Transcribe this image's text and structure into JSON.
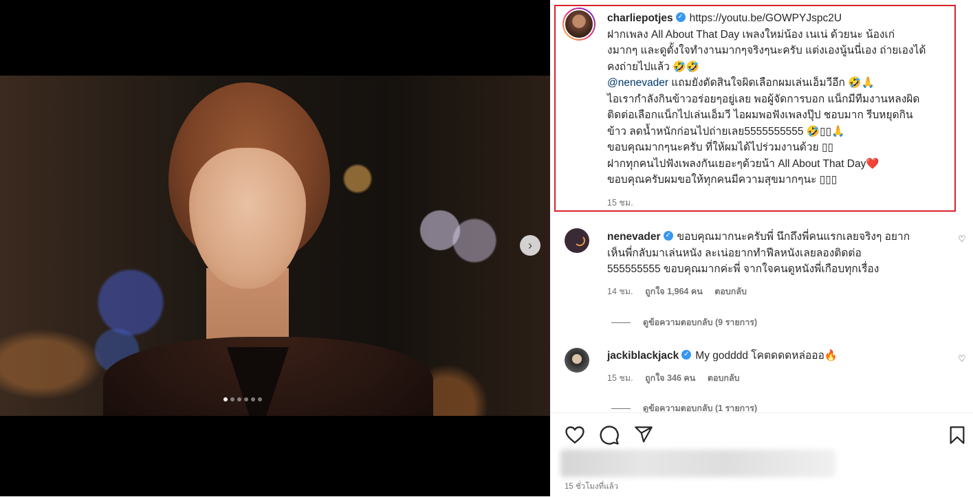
{
  "media": {
    "carousel_total": 6,
    "carousel_active": 1
  },
  "caption": {
    "username": "charliepotjes",
    "lines": [
      "https://youtu.be/GOWPYJspc2U",
      "ฝากเพลง All About That Day เพลงใหม่น้อง เนเน่ ด้วยนะ น้องเก่",
      "งมากๆ และดูตั้งใจทำงานมากๆจริงๆนะครับ แต่งเองนู้นนี่เอง ถ่ายเองได้",
      "คงถ่ายไปแล้ว 🤣🤣",
      "@nenevader แถมยังตัดสินใจผิดเลือกผมเล่นเอ็มวีอีก 🤣🙏",
      "ไอเรากำลังกินข้าวอร่อยๆอยู่เลย พอผู้จัดการบอก แน็กมีทีมงานหลงผิด",
      "ติดต่อเลือกแน็กไปเล่นเอ็มวี ไอผมพอฟังเพลงปุ๊ป ชอบมาก รีบหยุดกิน",
      "ข้าว ลดน้ำหนักก่อนไปถ่ายเลย5555555555 🤣▯▯🙏",
      "ขอบคุณมากๆนะครับ ที่ให้ผมได้ไปร่วมงานด้วย ▯▯",
      "ฝากทุกคนไปฟังเพลงกันเยอะๆด้วยน้า All About That Day❤️",
      "ขอบคุณครับผมขอให้ทุกคนมีความสุขมากๆนะ ▯▯▯"
    ],
    "time": "15 ชม."
  },
  "comments": [
    {
      "username": "nenevader",
      "lines": [
        "ขอบคุณมากนะครับพี่ นึกถึงพี่คนแรกเลยจริงๆ อยาก",
        "เห็นพี่กลับมาเล่นหนัง ละเน่อยากทำฟีลหนังเลยลองติดต่อ",
        "555555555 ขอบคุณมากค่ะพี่ จากใจคนดูหนังพี่เกือบทุกเรื่อง"
      ],
      "time": "14 ชม.",
      "likes": "ถูกใจ 1,964 คน",
      "reply": "ตอบกลับ",
      "view_replies": "ดูข้อความตอบกลับ (9 รายการ)"
    },
    {
      "username": "jackiblackjack",
      "text": "My godddd โคตดดดหล่อออ🔥",
      "time": "15 ชม.",
      "likes": "ถูกใจ 346 คน",
      "reply": "ตอบกลับ",
      "view_replies": "ดูข้อความตอบกลับ (1 รายการ)"
    }
  ],
  "footer": {
    "time_ago": "15 ชั่วโมงที่แล้ว"
  },
  "icons": {
    "like": "heart-icon",
    "comment": "comment-icon",
    "share": "share-icon",
    "save": "bookmark-icon",
    "next": "chevron-right-icon"
  },
  "colors": {
    "highlight_border": "#d9202a",
    "verified": "#3797f0",
    "mention": "#00376b"
  }
}
